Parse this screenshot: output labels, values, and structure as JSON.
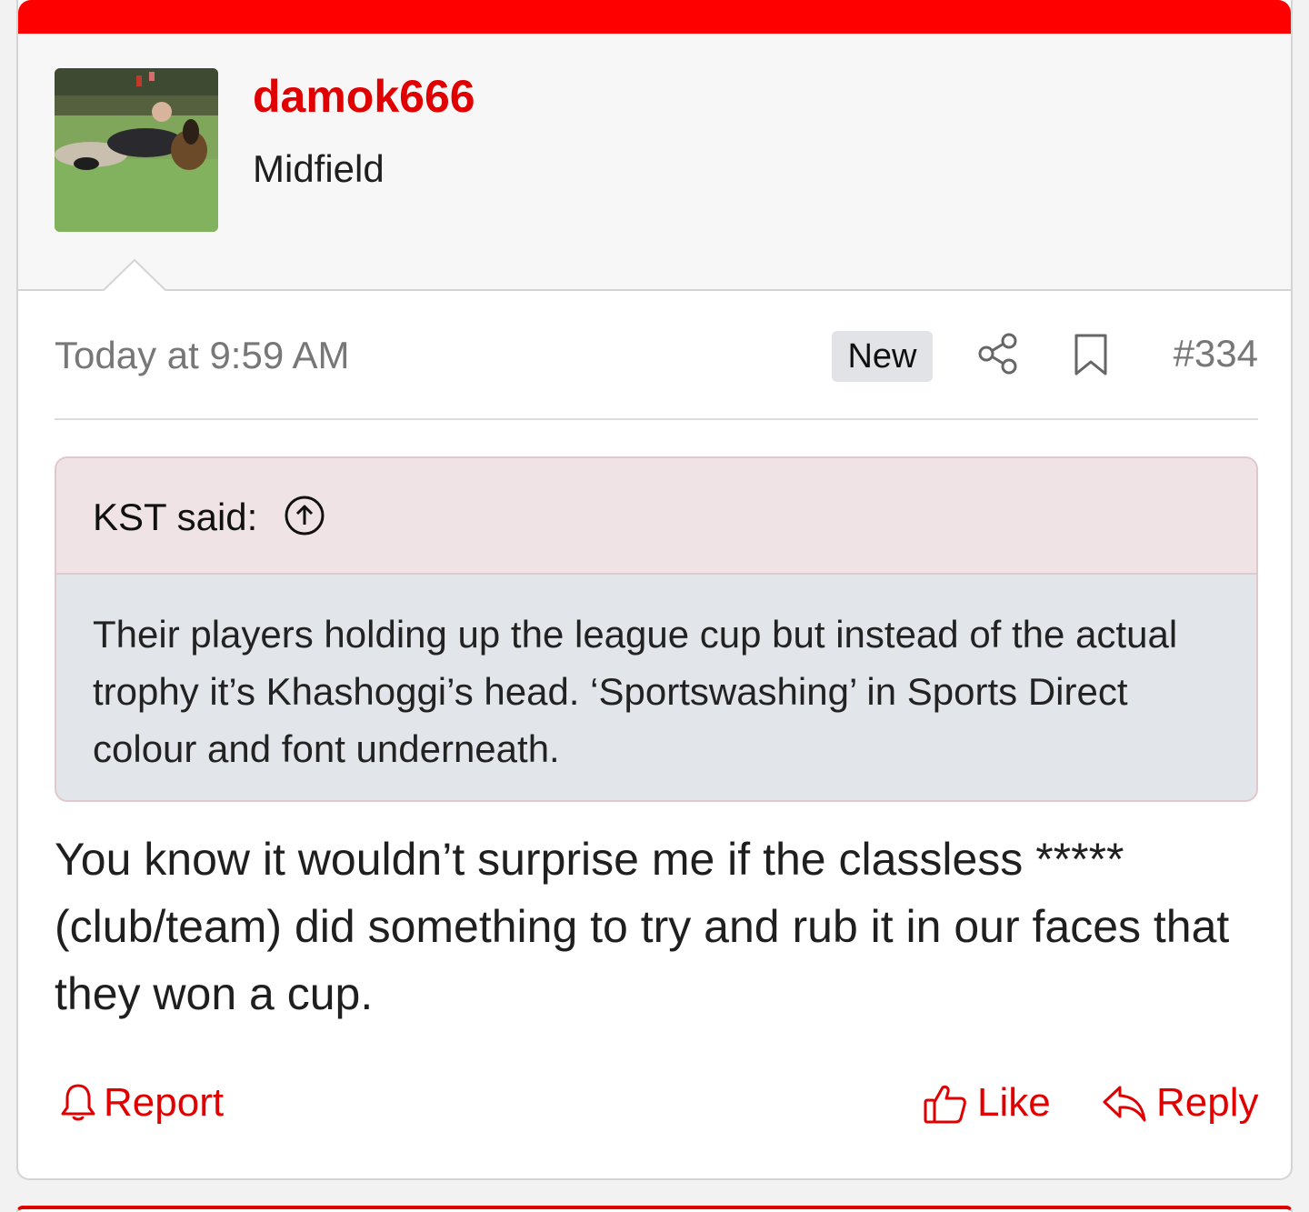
{
  "user": {
    "username": "damok666",
    "title": "Midfield",
    "avatar_desc_icon": "avatar-photo"
  },
  "meta": {
    "timestamp": "Today at 9:59 AM",
    "badge": "New",
    "post_number": "#334"
  },
  "quote": {
    "author_label": "KST said:",
    "text": "Their players holding up the league cup but instead of the actual trophy it’s Khashoggi’s head. ‘Sportswashing’ in Sports Direct colour and font underneath."
  },
  "message": "You know it wouldn’t surprise me if the classless ***** (club/team) did something to try and rub it in our faces that they won a cup.",
  "actions": {
    "report_label": "Report",
    "like_label": "Like",
    "reply_label": "Reply"
  },
  "colors": {
    "accent": "#e00000",
    "topbar": "#ff0000",
    "quote_head_bg": "#f0e3e6",
    "quote_body_bg": "#e2e5e9"
  }
}
